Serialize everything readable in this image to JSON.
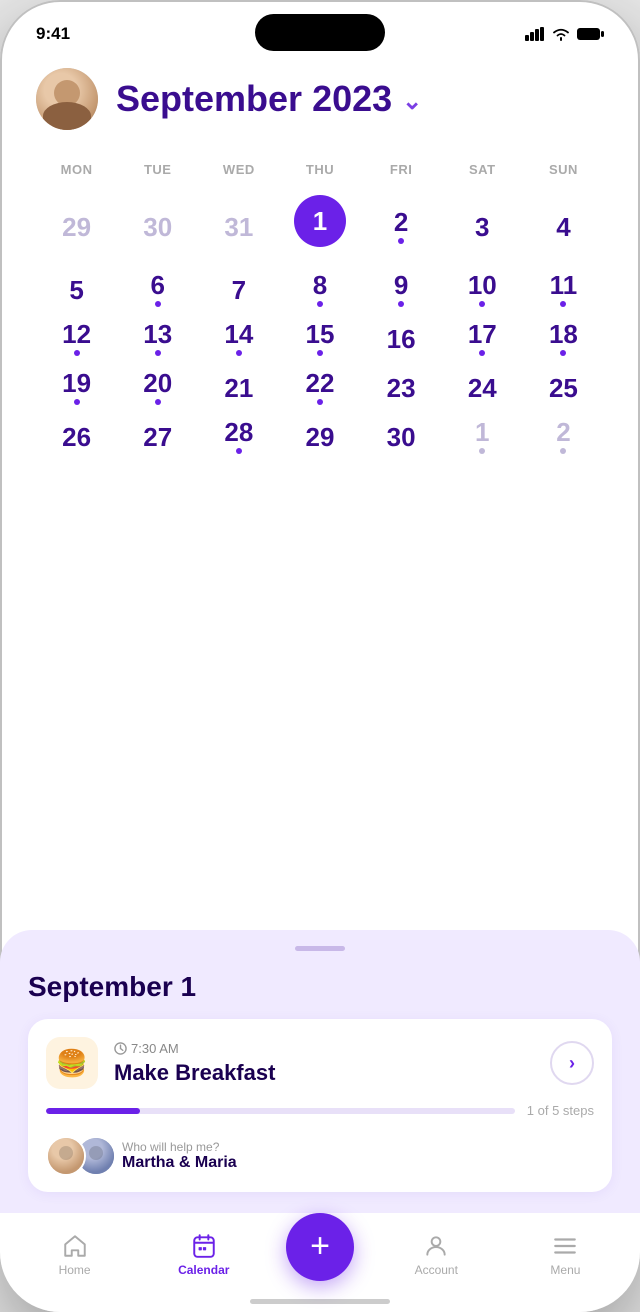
{
  "status": {
    "time": "9:41"
  },
  "header": {
    "month_year": "September 2023"
  },
  "calendar": {
    "day_names": [
      "MON",
      "TUE",
      "WED",
      "THU",
      "FRI",
      "SAT",
      "SUN"
    ],
    "weeks": [
      [
        {
          "num": "29",
          "muted": true,
          "dot": false,
          "today": false
        },
        {
          "num": "30",
          "muted": true,
          "dot": false,
          "today": false
        },
        {
          "num": "31",
          "muted": true,
          "dot": false,
          "today": false
        },
        {
          "num": "1",
          "muted": false,
          "dot": true,
          "today": true
        },
        {
          "num": "2",
          "muted": false,
          "dot": true,
          "today": false
        },
        {
          "num": "3",
          "muted": false,
          "dot": false,
          "today": false
        },
        {
          "num": "4",
          "muted": false,
          "dot": false,
          "today": false
        }
      ],
      [
        {
          "num": "5",
          "muted": false,
          "dot": false,
          "today": false
        },
        {
          "num": "6",
          "muted": false,
          "dot": true,
          "today": false
        },
        {
          "num": "7",
          "muted": false,
          "dot": false,
          "today": false
        },
        {
          "num": "8",
          "muted": false,
          "dot": true,
          "today": false
        },
        {
          "num": "9",
          "muted": false,
          "dot": true,
          "today": false
        },
        {
          "num": "10",
          "muted": false,
          "dot": true,
          "today": false
        },
        {
          "num": "11",
          "muted": false,
          "dot": true,
          "today": false
        }
      ],
      [
        {
          "num": "12",
          "muted": false,
          "dot": true,
          "today": false
        },
        {
          "num": "13",
          "muted": false,
          "dot": true,
          "today": false
        },
        {
          "num": "14",
          "muted": false,
          "dot": true,
          "today": false
        },
        {
          "num": "15",
          "muted": false,
          "dot": true,
          "today": false
        },
        {
          "num": "16",
          "muted": false,
          "dot": false,
          "today": false
        },
        {
          "num": "17",
          "muted": false,
          "dot": true,
          "today": false
        },
        {
          "num": "18",
          "muted": false,
          "dot": true,
          "today": false
        }
      ],
      [
        {
          "num": "19",
          "muted": false,
          "dot": true,
          "today": false
        },
        {
          "num": "20",
          "muted": false,
          "dot": true,
          "today": false
        },
        {
          "num": "21",
          "muted": false,
          "dot": false,
          "today": false
        },
        {
          "num": "22",
          "muted": false,
          "dot": true,
          "today": false
        },
        {
          "num": "23",
          "muted": false,
          "dot": false,
          "today": false
        },
        {
          "num": "24",
          "muted": false,
          "dot": false,
          "today": false
        },
        {
          "num": "25",
          "muted": false,
          "dot": false,
          "today": false
        }
      ],
      [
        {
          "num": "26",
          "muted": false,
          "dot": false,
          "today": false
        },
        {
          "num": "27",
          "muted": false,
          "dot": false,
          "today": false
        },
        {
          "num": "28",
          "muted": false,
          "dot": true,
          "today": false
        },
        {
          "num": "29",
          "muted": false,
          "dot": false,
          "today": false
        },
        {
          "num": "30",
          "muted": false,
          "dot": false,
          "today": false
        },
        {
          "num": "1",
          "muted": true,
          "dot": true,
          "today": false
        },
        {
          "num": "2",
          "muted": true,
          "dot": true,
          "today": false
        }
      ]
    ]
  },
  "sheet": {
    "date": "September 1",
    "event": {
      "time": "7:30 AM",
      "title": "Make Breakfast",
      "icon": "🍔",
      "progress_text": "1 of  5 steps",
      "progress_percent": 20
    },
    "helpers": {
      "label": "Who will help me?",
      "names": "Martha & Maria"
    }
  },
  "nav": {
    "items": [
      {
        "label": "Home",
        "active": false
      },
      {
        "label": "Calendar",
        "active": true
      },
      {
        "label": "",
        "fab": true
      },
      {
        "label": "Account",
        "active": false
      },
      {
        "label": "Menu",
        "active": false
      }
    ],
    "fab_label": "+"
  }
}
